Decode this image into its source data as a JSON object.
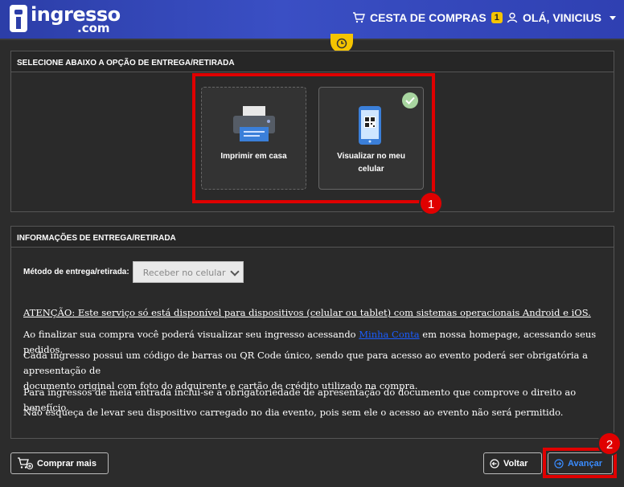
{
  "header": {
    "logo_main": "ingresso",
    "logo_sub": ".com",
    "cart_label": "CESTA DE COMPRAS",
    "cart_count": "1",
    "user_label": "OLÁ, VINICIUS"
  },
  "delivery_panel": {
    "title": "SELECIONE ABAIXO A OPÇÃO DE ENTREGA/RETIRADA",
    "options": [
      {
        "label": "Imprimir em casa",
        "selected": false
      },
      {
        "label_line1": "Visualizar no meu",
        "label_line2": "celular",
        "selected": true
      }
    ]
  },
  "info_panel": {
    "title": "INFORMAÇÕES DE ENTREGA/RETIRADA",
    "method_label": "Método de entrega/retirada:",
    "method_value": "Receber no celular",
    "attention": "ATENÇÃO: Este serviço só está disponível para dispositivos (celular ou tablet) com sistemas operacionais Android e iOS.",
    "para2_before": "Ao finalizar sua compra você poderá visualizar seu ingresso acessando ",
    "para2_link": "Minha Conta",
    "para2_after": " em nossa homepage, acessando seus pedidos.",
    "para3_line1": "Cada ingresso possui um código de barras ou QR Code único, sendo que para acesso ao evento poderá ser obrigatória a apresentação de",
    "para3_line2": "documento original com foto do adquirente e cartão de crédito utilizado na compra.",
    "para4": "Para ingressos de meia entrada inclui-se a obrigatoriedade de apresentação do documento que comprove o direito ao benefício.",
    "para5": "Não esqueça de levar seu dispositivo carregado no dia evento, pois sem ele o acesso ao evento não será permitido."
  },
  "footer": {
    "more_label": "Comprar mais",
    "back_label": "Voltar",
    "next_label": "Avançar"
  },
  "annotations": {
    "marker1": "1",
    "marker2": "2"
  },
  "colors": {
    "header_bg": "#2c3ea8",
    "badge": "#f5c400",
    "highlight": "#e00000",
    "next_text": "#3a8cff",
    "link": "#1a5cff"
  }
}
